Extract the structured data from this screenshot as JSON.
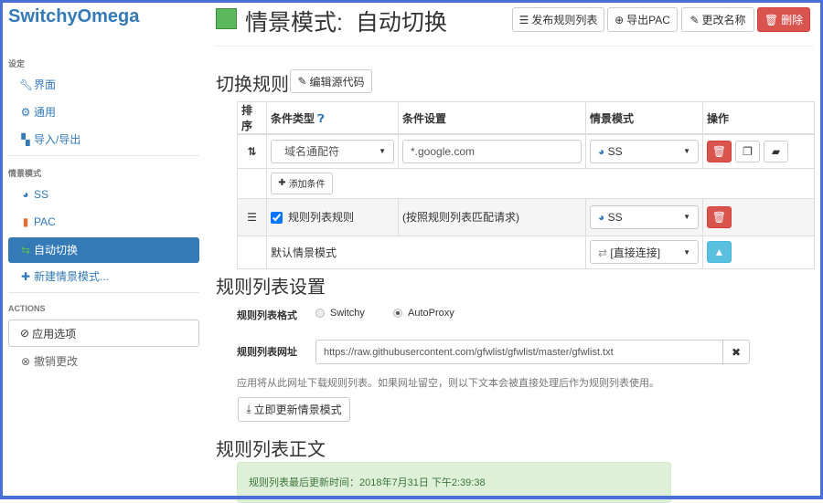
{
  "app": {
    "name": "SwitchyOmega"
  },
  "sidebar": {
    "settings_header": "设定",
    "settings_items": [
      {
        "label": "界面",
        "icon": "wrench-icon"
      },
      {
        "label": "通用",
        "icon": "gear-icon"
      },
      {
        "label": "导入/导出",
        "icon": "floppy-icon"
      }
    ],
    "profiles_header": "情景模式",
    "profiles": [
      {
        "label": "SS",
        "icon": "globe-icon"
      },
      {
        "label": "PAC",
        "icon": "file-icon"
      },
      {
        "label": "自动切换",
        "icon": "switch-icon",
        "active": true
      }
    ],
    "new_profile": "新建情景模式...",
    "actions_header": "ACTIONS",
    "apply": "应用选项",
    "discard": "撤销更改"
  },
  "header": {
    "title": "情景模式:  自动切换",
    "profile_color": "#5cb85c",
    "publish": "发布规则列表",
    "export_pac": "导出PAC",
    "rename": "更改名称",
    "delete": "删除"
  },
  "rules": {
    "heading": "切换规则",
    "edit_source": "编辑源代码",
    "columns": [
      "排序",
      "条件类型",
      "条件设置",
      "情景模式",
      "操作"
    ],
    "rows": [
      {
        "type": "域名通配符",
        "pattern": "*.google.com",
        "profile": "SS"
      }
    ],
    "add_condition": "添加条件",
    "rule_list_row": {
      "label": "规则列表规则",
      "checked": true,
      "desc": "(按照规则列表匹配请求)",
      "profile": "SS"
    },
    "default_row": {
      "label": "默认情景模式",
      "profile": "[直接连接]"
    }
  },
  "rule_list_settings": {
    "heading": "规则列表设置",
    "format_label": "规则列表格式",
    "formats": [
      "Switchy",
      "AutoProxy"
    ],
    "selected_format": "AutoProxy",
    "url_label": "规则列表网址",
    "url": "https://raw.githubusercontent.com/gfwlist/gfwlist/master/gfwlist.txt",
    "help": "应用将从此网址下载规则列表。如果网址留空，则以下文本会被直接处理后作为规则列表使用。",
    "update_now": "立即更新情景模式"
  },
  "rule_list_text": {
    "heading": "规则列表正文",
    "last_updated": "规则列表最后更新时间：2018年7月31日 下午2:39:38"
  }
}
